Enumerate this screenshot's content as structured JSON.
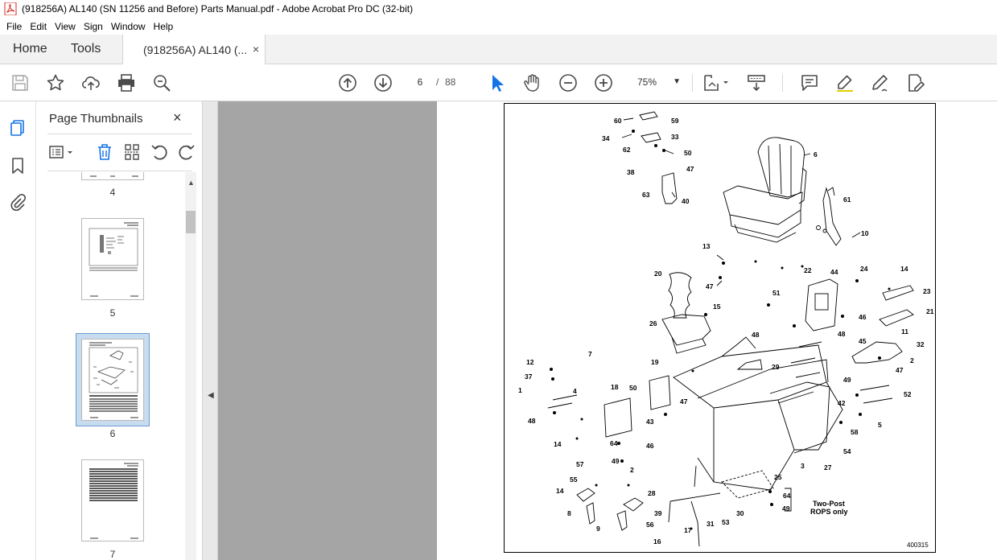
{
  "window": {
    "title": "(918256A) AL140 (SN 11256 and Before) Parts Manual.pdf - Adobe Acrobat Pro DC (32-bit)"
  },
  "menu": [
    "File",
    "Edit",
    "View",
    "Sign",
    "Window",
    "Help"
  ],
  "tabs": {
    "home": "Home",
    "tools": "Tools",
    "document": "(918256A) AL140 (...",
    "close": "×"
  },
  "toolbar": {
    "current_page": "6",
    "page_separator": "/",
    "total_pages": "88",
    "zoom": "75%"
  },
  "panel": {
    "title": "Page Thumbnails",
    "close": "×",
    "thumbnails": [
      {
        "label": "4"
      },
      {
        "label": "5"
      },
      {
        "label": "6",
        "selected": true
      },
      {
        "label": "7"
      }
    ]
  },
  "drawing": {
    "callouts": [
      "60",
      "59",
      "34",
      "33",
      "62",
      "50",
      "38",
      "47",
      "63",
      "40",
      "6",
      "61",
      "10",
      "13",
      "47",
      "14",
      "20",
      "22",
      "44",
      "24",
      "23",
      "21",
      "46",
      "48",
      "15",
      "51",
      "26",
      "48",
      "11",
      "45",
      "32",
      "2",
      "47",
      "7",
      "12",
      "19",
      "29",
      "37",
      "1",
      "4",
      "18",
      "50",
      "47",
      "49",
      "52",
      "48",
      "43",
      "42",
      "5",
      "58",
      "14",
      "46",
      "64",
      "54",
      "49",
      "57",
      "55",
      "2",
      "25",
      "3",
      "27",
      "14",
      "28",
      "64",
      "8",
      "39",
      "30",
      "49",
      "56",
      "31",
      "53",
      "9",
      "17",
      "16"
    ],
    "note": "Two-Post ROPS only",
    "note_line1": "Two-Post",
    "note_line2": "ROPS only",
    "drawing_number": "400315"
  },
  "colors": {
    "accent": "#1473e6",
    "doc_background": "#a5a5a5",
    "acrobat_red": "#d7281d"
  }
}
